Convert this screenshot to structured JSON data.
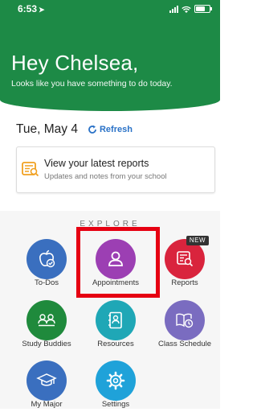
{
  "status": {
    "time": "6:53"
  },
  "header": {
    "greeting": "Hey Chelsea,",
    "subtitle": "Looks like you have something to do today."
  },
  "date": {
    "label": "Tue, May 4",
    "refresh": "Refresh"
  },
  "card": {
    "title": "View your latest reports",
    "subtitle": "Updates and notes from your school",
    "icon": "report-icon"
  },
  "explore": {
    "heading": "EXPLORE",
    "badge": "NEW",
    "tiles": [
      {
        "label": "To-Dos",
        "icon": "apple-check-icon",
        "color": "#3a6fbf"
      },
      {
        "label": "Appointments",
        "icon": "person-icon",
        "color": "#9c3fb3"
      },
      {
        "label": "Reports",
        "icon": "report-icon",
        "color": "#d9243d"
      },
      {
        "label": "Study Buddies",
        "icon": "group-icon",
        "color": "#1f8a3c"
      },
      {
        "label": "Resources",
        "icon": "address-book-icon",
        "color": "#1fa7b6"
      },
      {
        "label": "Class Schedule",
        "icon": "book-clock-icon",
        "color": "#7a6cc0"
      },
      {
        "label": "My Major",
        "icon": "graduation-cap-icon",
        "color": "#3a6fbf"
      },
      {
        "label": "Settings",
        "icon": "gear-icon",
        "color": "#1fa2d9"
      }
    ]
  },
  "colors": {
    "header": "#1d8a46",
    "link": "#2a72c7",
    "highlight": "#e60012"
  }
}
